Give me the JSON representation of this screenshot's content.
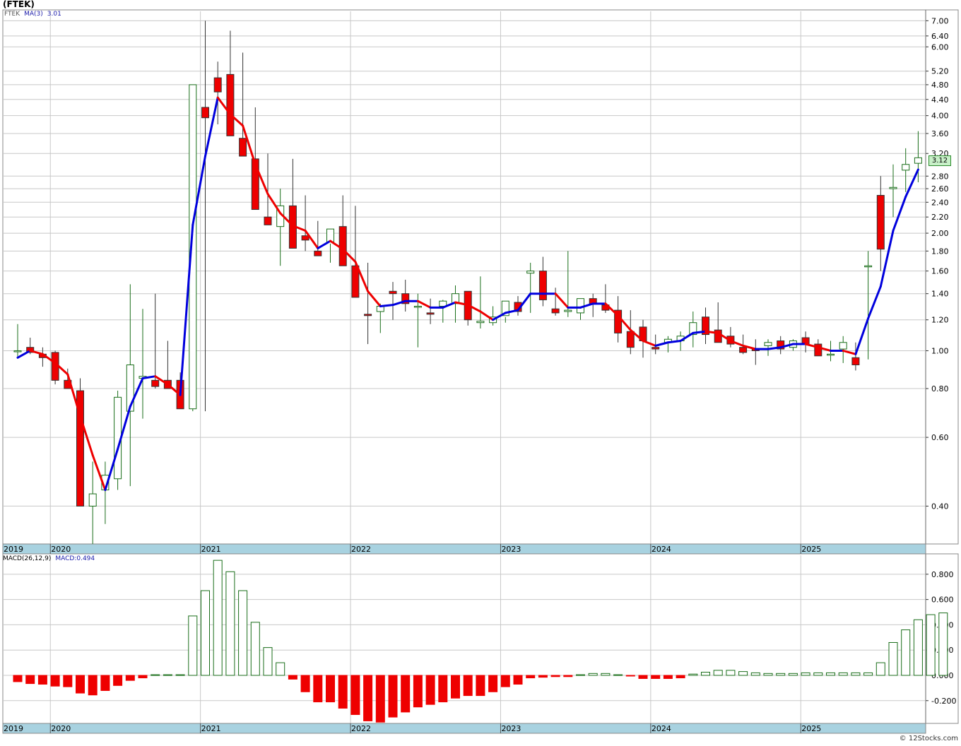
{
  "ticker_label": "(FTEK)",
  "price_legend": {
    "symbol": "FTEK",
    "ma_label": "MA(3)",
    "ma_value": "3.01"
  },
  "macd_legend": {
    "label": "MACD(26,12,9)",
    "value": "MACD:0.494"
  },
  "last_price_badge": "3.12",
  "watermark": "© 12Stocks.com",
  "colors": {
    "up": "#1a6e1a",
    "down": "#ee0000",
    "ma_up": "#0000dd",
    "ma_down": "#ee0000",
    "axis_band": "#a8d2e0",
    "grid": "#c8c8c8"
  },
  "chart_data": [
    {
      "type": "candlestick",
      "title": "",
      "scale": "log",
      "yticks": [
        0.4,
        0.6,
        0.8,
        1.0,
        1.2,
        1.4,
        1.6,
        1.8,
        2.0,
        2.2,
        2.4,
        2.6,
        2.8,
        3.2,
        3.6,
        4.0,
        4.4,
        4.8,
        5.2,
        6.0,
        6.4,
        7.0
      ],
      "ytick_labels": [
        "0.40",
        "0.60",
        "0.80",
        "1.00",
        "1.20",
        "1.40",
        "1.60",
        "1.80",
        "2.00",
        "2.20",
        "2.40",
        "2.60",
        "2.80",
        "3.20",
        "3.60",
        "4.00",
        "4.40",
        "4.80",
        "5.20",
        "6.00",
        "6.40",
        "7.00"
      ],
      "xaxis_labels": [
        "2019",
        "2020",
        "2021",
        "2022",
        "2023",
        "2024",
        "2025"
      ],
      "xaxis_label_month_index": [
        0,
        3,
        15,
        27,
        39,
        51,
        63
      ],
      "grid": true,
      "series": [
        {
          "name": "FTEK",
          "months": [
            "2019-10",
            "2019-11",
            "2019-12",
            "2020-01",
            "2020-02",
            "2020-03",
            "2020-04",
            "2020-05",
            "2020-06",
            "2020-07",
            "2020-08",
            "2020-09",
            "2020-10",
            "2020-11",
            "2020-12",
            "2021-01",
            "2021-02",
            "2021-03",
            "2021-04",
            "2021-05",
            "2021-06",
            "2021-07",
            "2021-08",
            "2021-09",
            "2021-10",
            "2021-11",
            "2021-12",
            "2022-01",
            "2022-02",
            "2022-03",
            "2022-04",
            "2022-05",
            "2022-06",
            "2022-07",
            "2022-08",
            "2022-09",
            "2022-10",
            "2022-11",
            "2022-12",
            "2023-01",
            "2023-02",
            "2023-03",
            "2023-04",
            "2023-05",
            "2023-06",
            "2023-07",
            "2023-08",
            "2023-09",
            "2023-10",
            "2023-11",
            "2023-12",
            "2024-01",
            "2024-02",
            "2024-03",
            "2024-04",
            "2024-05",
            "2024-06",
            "2024-07",
            "2024-08",
            "2024-09",
            "2024-10",
            "2024-11",
            "2024-12",
            "2025-01",
            "2025-02",
            "2025-03",
            "2025-04",
            "2025-05",
            "2025-06",
            "2025-07",
            "2025-08",
            "2025-09",
            "2025-10"
          ],
          "open": [
            1.0,
            1.02,
            0.98,
            0.99,
            0.84,
            0.79,
            0.4,
            0.44,
            0.47,
            0.7,
            0.85,
            0.84,
            0.84,
            0.84,
            0.71,
            4.2,
            5.0,
            5.1,
            3.5,
            3.1,
            2.2,
            2.08,
            2.35,
            1.97,
            1.8,
            1.9,
            2.08,
            1.65,
            1.24,
            1.26,
            1.42,
            1.4,
            1.3,
            1.25,
            1.3,
            1.32,
            1.42,
            1.18,
            1.18,
            1.23,
            1.33,
            1.58,
            1.6,
            1.28,
            1.26,
            1.25,
            1.36,
            1.31,
            1.27,
            1.12,
            1.15,
            1.02,
            1.05,
            1.06,
            1.1,
            1.22,
            1.13,
            1.09,
            1.02,
            1.01,
            1.03,
            1.06,
            1.02,
            1.08,
            1.04,
            0.98,
            1.01,
            0.96,
            1.65,
            2.5,
            2.6,
            2.9,
            3.02
          ],
          "high": [
            1.17,
            1.08,
            1.02,
            1.0,
            0.9,
            0.85,
            0.52,
            0.52,
            0.79,
            1.48,
            1.28,
            1.4,
            1.06,
            0.88,
            0.86,
            7.0,
            5.5,
            6.6,
            5.8,
            4.2,
            3.2,
            2.6,
            3.1,
            2.5,
            2.15,
            1.88,
            2.5,
            2.35,
            1.68,
            1.32,
            1.5,
            1.52,
            1.4,
            1.36,
            1.35,
            1.47,
            1.42,
            1.55,
            1.3,
            1.22,
            1.38,
            1.68,
            1.74,
            1.45,
            1.8,
            1.31,
            1.4,
            1.48,
            1.38,
            1.27,
            1.2,
            1.1,
            1.09,
            1.12,
            1.26,
            1.29,
            1.33,
            1.15,
            1.1,
            1.07,
            1.07,
            1.09,
            1.07,
            1.12,
            1.07,
            1.06,
            1.09,
            1.05,
            1.8,
            2.8,
            3.0,
            3.3,
            3.65
          ],
          "low": [
            0.96,
            0.98,
            0.91,
            0.82,
            0.82,
            0.74,
            0.32,
            0.36,
            0.44,
            0.45,
            0.67,
            0.8,
            0.8,
            0.76,
            0.7,
            0.7,
            3.8,
            3.9,
            3.25,
            2.65,
            2.1,
            1.65,
            2.02,
            1.8,
            1.75,
            1.68,
            1.65,
            1.55,
            1.04,
            1.11,
            1.2,
            1.26,
            1.02,
            1.17,
            1.18,
            1.18,
            1.16,
            1.14,
            1.16,
            1.18,
            1.23,
            1.25,
            1.3,
            1.23,
            1.22,
            1.2,
            1.22,
            1.25,
            1.05,
            0.98,
            0.96,
            0.98,
            0.99,
            1.0,
            1.02,
            1.04,
            1.1,
            1.02,
            0.98,
            0.92,
            0.97,
            0.98,
            1.0,
            0.99,
            0.97,
            0.94,
            0.93,
            0.89,
            0.95,
            1.6,
            2.2,
            2.55,
            2.7
          ],
          "close": [
            1.0,
            0.99,
            0.96,
            0.84,
            0.8,
            0.4,
            0.43,
            0.48,
            0.76,
            0.92,
            0.86,
            0.81,
            0.8,
            0.71,
            4.8,
            3.95,
            4.6,
            3.55,
            3.15,
            2.3,
            2.1,
            2.35,
            1.83,
            1.92,
            1.75,
            2.05,
            1.65,
            1.37,
            1.23,
            1.3,
            1.4,
            1.32,
            1.3,
            1.24,
            1.34,
            1.4,
            1.2,
            1.19,
            1.22,
            1.34,
            1.26,
            1.6,
            1.35,
            1.25,
            1.27,
            1.36,
            1.32,
            1.27,
            1.11,
            1.02,
            1.06,
            1.01,
            1.07,
            1.09,
            1.18,
            1.1,
            1.05,
            1.04,
            0.99,
            1.0,
            1.05,
            1.01,
            1.06,
            1.04,
            0.97,
            0.98,
            1.05,
            0.92,
            1.65,
            1.82,
            2.62,
            3.0,
            3.12
          ]
        },
        {
          "name": "MA(3)",
          "values": [
            0.96,
            1.0,
            0.98,
            0.93,
            0.87,
            0.68,
            0.54,
            0.44,
            0.56,
            0.72,
            0.85,
            0.86,
            0.82,
            0.77,
            2.1,
            3.15,
            4.45,
            4.03,
            3.77,
            3.0,
            2.52,
            2.25,
            2.09,
            2.03,
            1.83,
            1.91,
            1.82,
            1.69,
            1.42,
            1.3,
            1.31,
            1.34,
            1.34,
            1.29,
            1.29,
            1.33,
            1.31,
            1.26,
            1.2,
            1.25,
            1.27,
            1.4,
            1.4,
            1.4,
            1.29,
            1.29,
            1.32,
            1.32,
            1.23,
            1.13,
            1.06,
            1.03,
            1.05,
            1.06,
            1.11,
            1.12,
            1.11,
            1.06,
            1.03,
            1.01,
            1.01,
            1.02,
            1.04,
            1.04,
            1.02,
            1.0,
            1.0,
            0.98,
            1.21,
            1.46,
            2.03,
            2.48,
            2.91
          ]
        }
      ]
    },
    {
      "type": "bar",
      "title": "MACD(26,12,9)",
      "ylim": [
        -0.38,
        0.95
      ],
      "yticks": [
        -0.2,
        0.0,
        0.2,
        0.4,
        0.6,
        0.8
      ],
      "ytick_labels": [
        "-0.200",
        "0.000",
        "0.200",
        "0.400",
        "0.600",
        "0.800"
      ],
      "xaxis_labels": [
        "2019",
        "2020",
        "2021",
        "2022",
        "2023",
        "2024",
        "2025"
      ],
      "series": [
        {
          "name": "MACD",
          "values": [
            -0.05,
            -0.065,
            -0.07,
            -0.085,
            -0.09,
            -0.14,
            -0.155,
            -0.12,
            -0.08,
            -0.04,
            -0.02,
            0.005,
            0.005,
            0.005,
            0.47,
            0.67,
            0.91,
            0.82,
            0.67,
            0.42,
            0.22,
            0.1,
            -0.03,
            -0.13,
            -0.21,
            -0.21,
            -0.26,
            -0.31,
            -0.36,
            -0.37,
            -0.33,
            -0.29,
            -0.25,
            -0.23,
            -0.21,
            -0.18,
            -0.16,
            -0.16,
            -0.13,
            -0.09,
            -0.07,
            -0.02,
            -0.015,
            -0.01,
            -0.01,
            0.005,
            0.015,
            0.015,
            0.005,
            -0.005,
            -0.025,
            -0.025,
            -0.025,
            -0.02,
            0.01,
            0.025,
            0.04,
            0.04,
            0.03,
            0.02,
            0.015,
            0.015,
            0.015,
            0.02,
            0.02,
            0.02,
            0.02,
            0.02,
            0.02,
            0.1,
            0.26,
            0.36,
            0.44,
            0.48,
            0.494
          ]
        }
      ]
    }
  ]
}
